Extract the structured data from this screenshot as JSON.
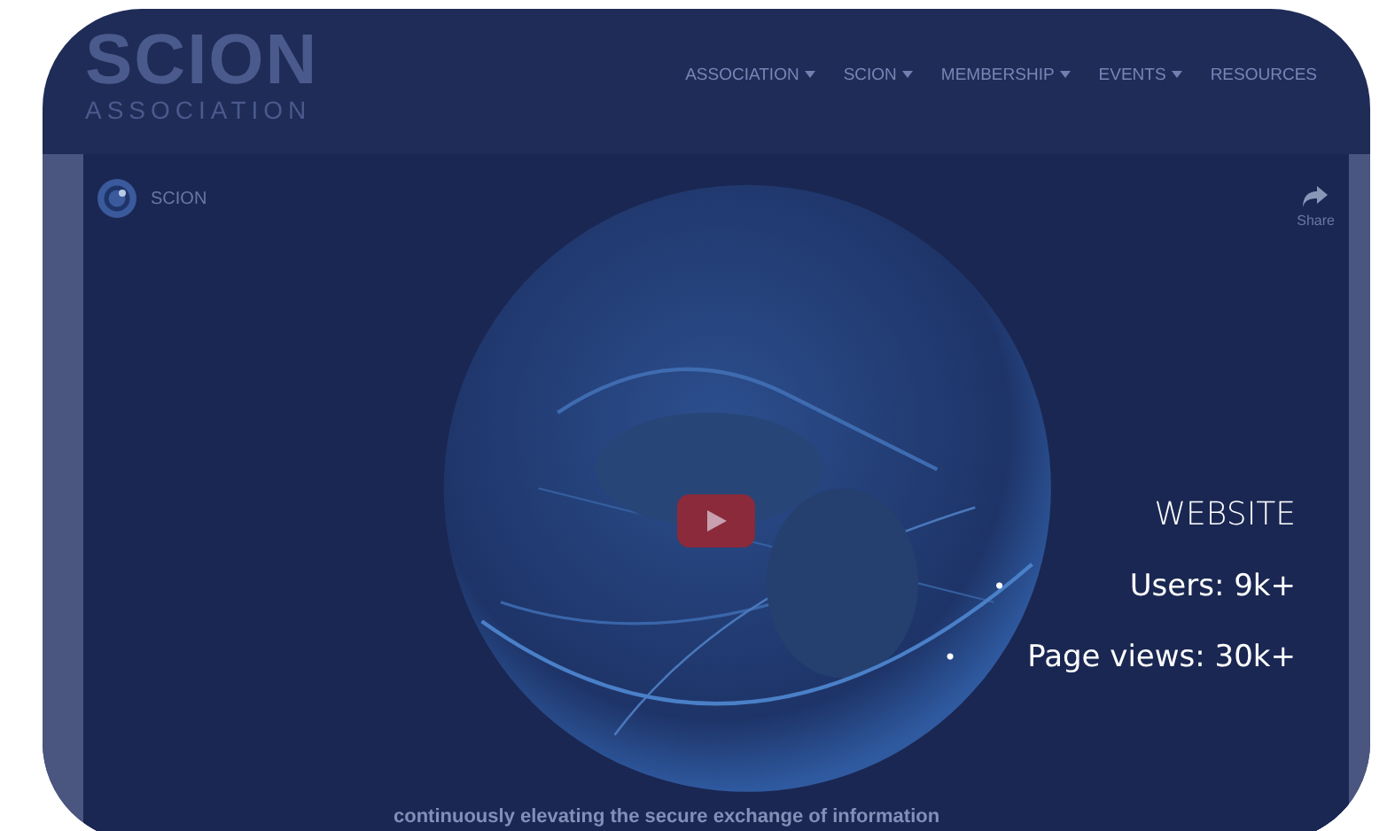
{
  "logo": {
    "name": "SCION",
    "subtitle": "ASSOCIATION"
  },
  "nav": [
    {
      "label": "ASSOCIATION",
      "dropdown": true
    },
    {
      "label": "SCION",
      "dropdown": true
    },
    {
      "label": "MEMBERSHIP",
      "dropdown": true
    },
    {
      "label": "EVENTS",
      "dropdown": true
    },
    {
      "label": "RESOURCES",
      "dropdown": false
    }
  ],
  "video": {
    "channel": "SCION",
    "share": "Share",
    "caption": "continuously elevating the secure exchange of information"
  },
  "stats": {
    "title": "WEBSITE",
    "items": [
      {
        "bullet": "•",
        "text": "Users: 9k+"
      },
      {
        "bullet": "•",
        "text": "Page views: 30k+"
      }
    ]
  }
}
